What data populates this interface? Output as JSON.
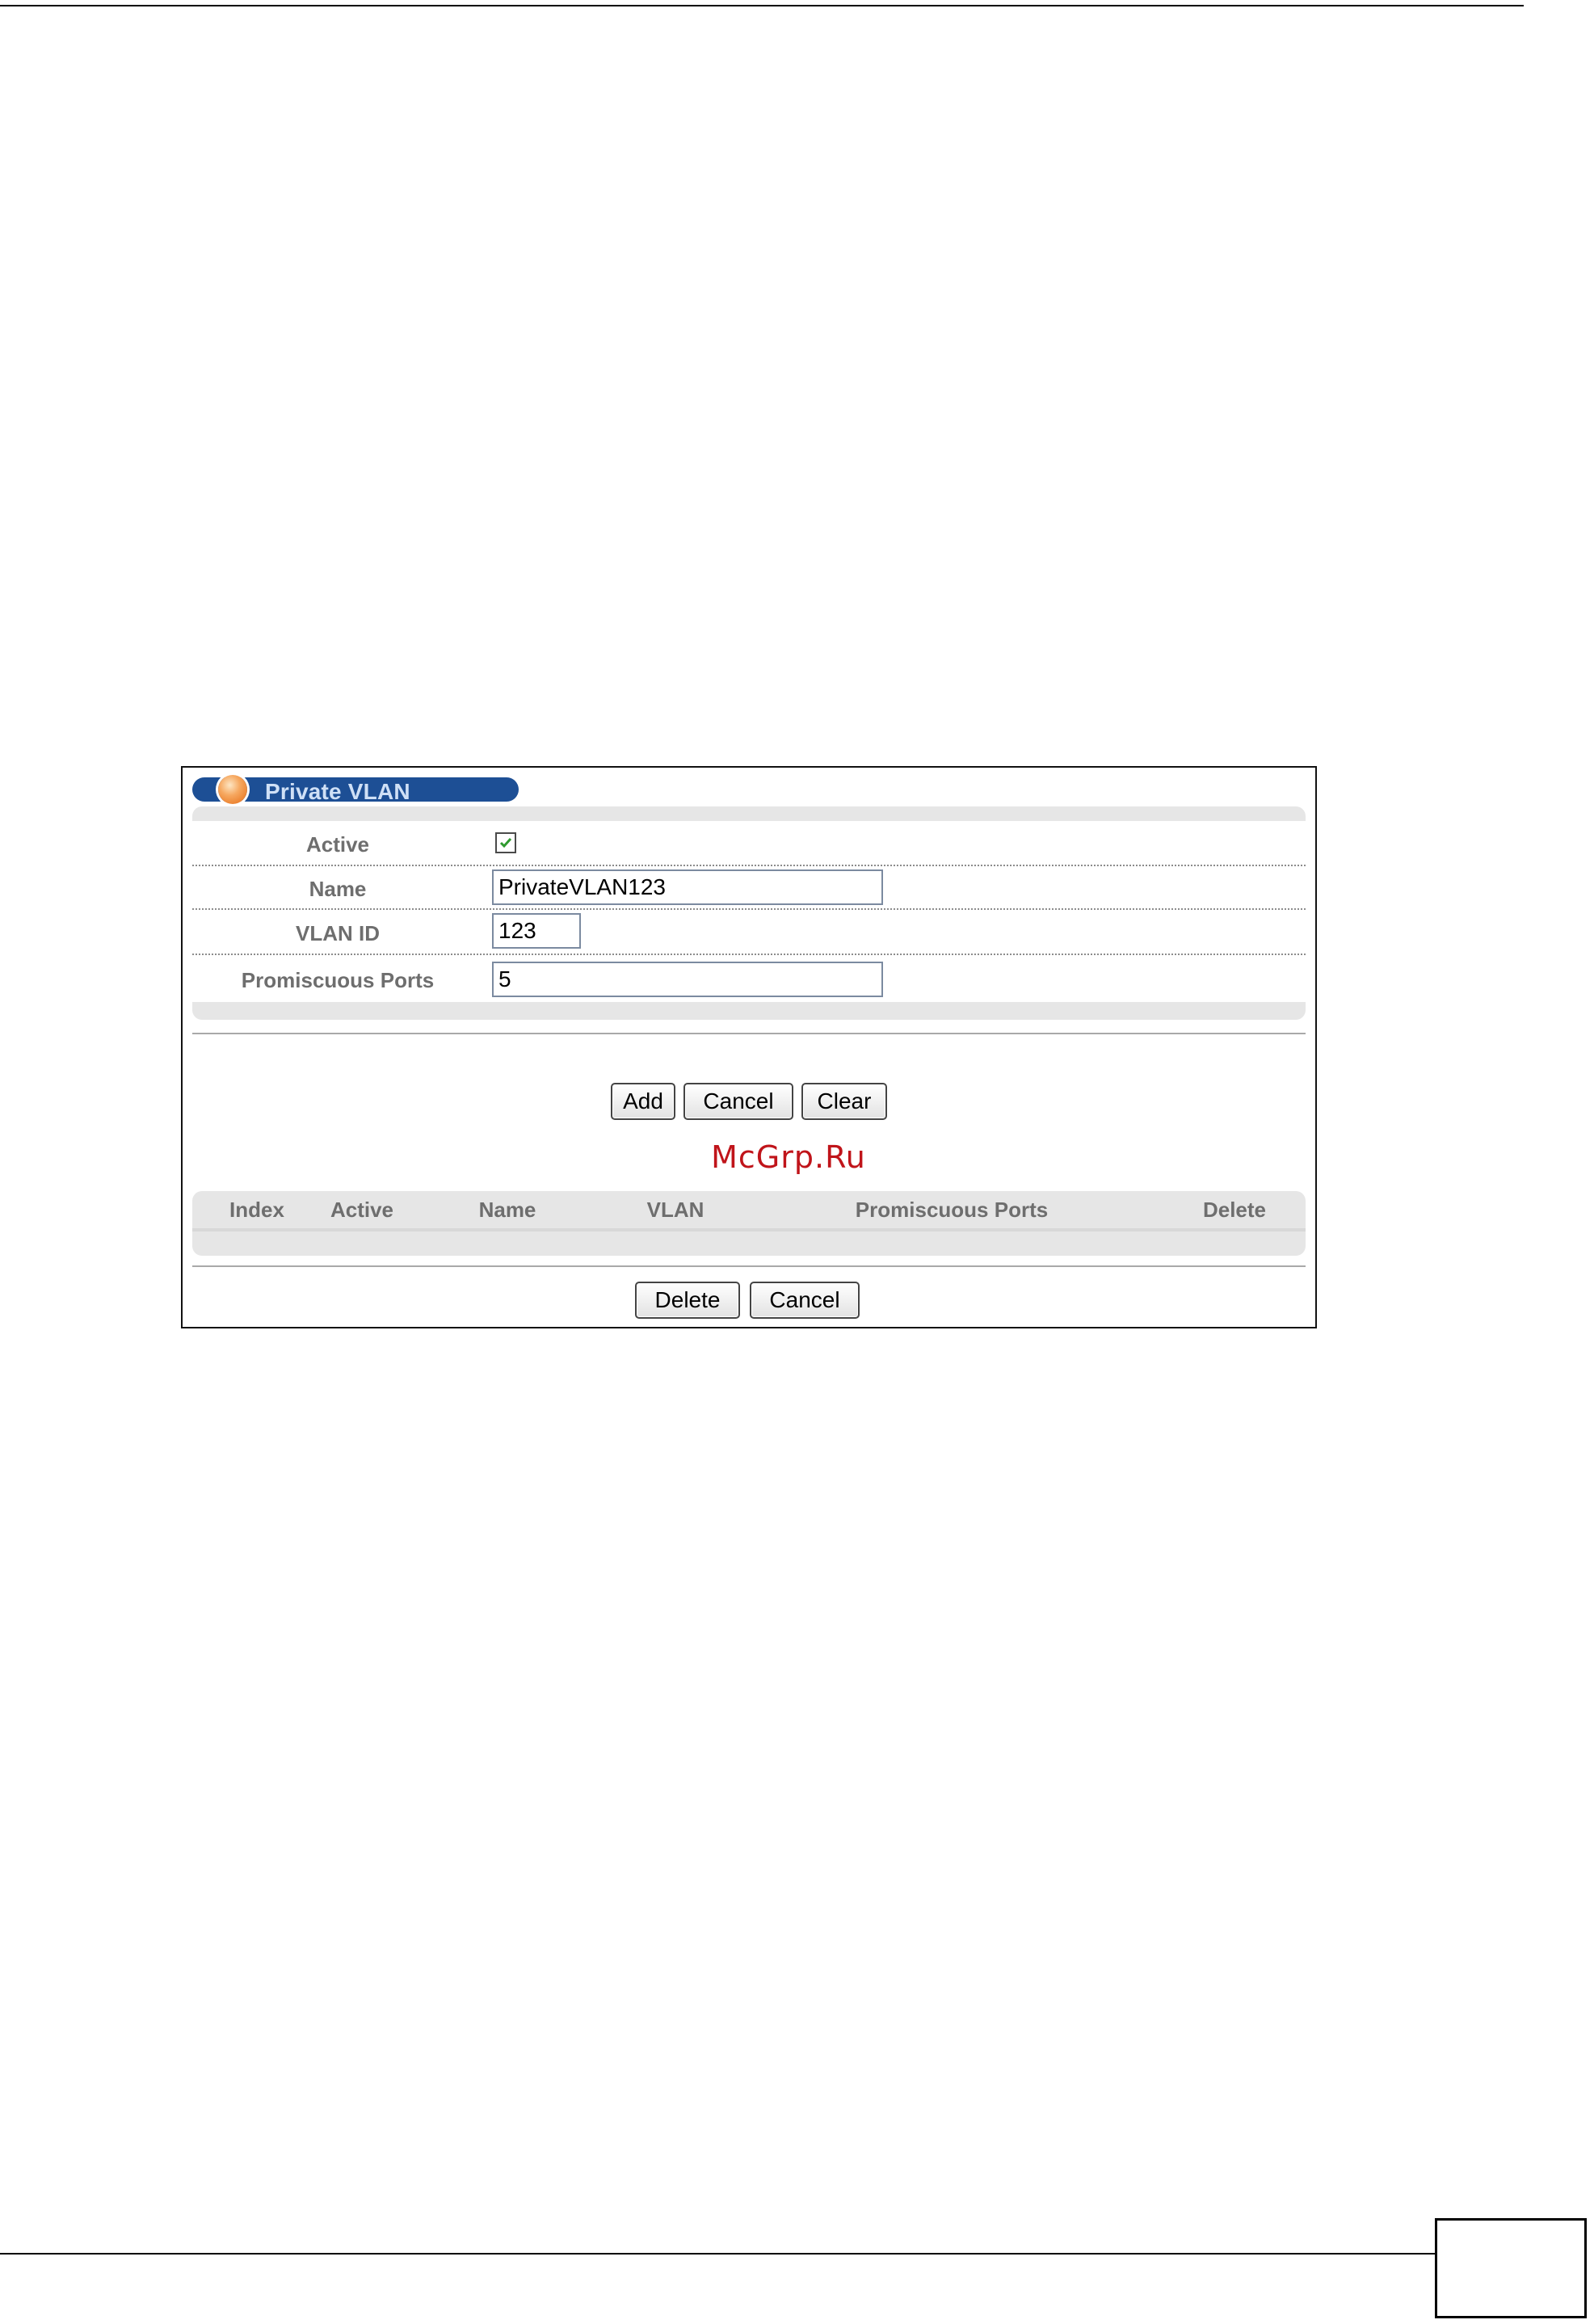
{
  "panel": {
    "title": "Private VLAN"
  },
  "form": {
    "active_label": "Active",
    "active_checked": true,
    "name_label": "Name",
    "name_value": "PrivateVLAN123",
    "vlan_id_label": "VLAN ID",
    "vlan_id_value": "123",
    "promiscuous_label": "Promiscuous Ports",
    "promiscuous_value": "5"
  },
  "actions": {
    "add_label": "Add",
    "cancel_label": "Cancel",
    "clear_label": "Clear"
  },
  "watermark": "McGrp.Ru",
  "table": {
    "columns": [
      "Index",
      "Active",
      "Name",
      "VLAN",
      "Promiscuous Ports",
      "Delete"
    ],
    "rows": []
  },
  "table_actions": {
    "delete_label": "Delete",
    "cancel_label": "Cancel"
  },
  "colors": {
    "title_bar": "#1d4f95",
    "title_text": "#cfe0f6",
    "label_gray": "#6e6e6e",
    "panel_fill": "#e6e6e6",
    "watermark": "#c0141a",
    "check_green": "#2e9a2e"
  }
}
